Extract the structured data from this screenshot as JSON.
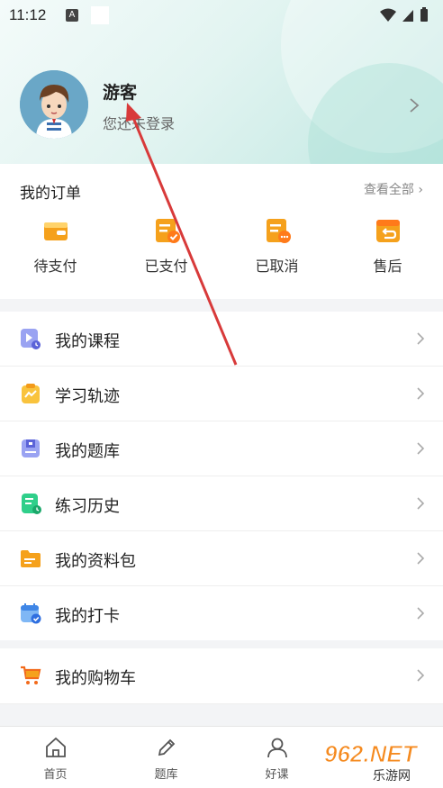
{
  "status_bar": {
    "time": "11:12",
    "notif_icon_letter": "A"
  },
  "profile": {
    "username": "游客",
    "login_hint": "您还未登录"
  },
  "orders": {
    "title": "我的订单",
    "view_all": "查看全部",
    "items": [
      {
        "label": "待支付",
        "icon": "wallet-icon"
      },
      {
        "label": "已支付",
        "icon": "paid-check-icon"
      },
      {
        "label": "已取消",
        "icon": "cancelled-doc-icon"
      },
      {
        "label": "售后",
        "icon": "return-box-icon"
      }
    ]
  },
  "menu": {
    "items": [
      {
        "label": "我的课程",
        "icon": "video-course-icon"
      },
      {
        "label": "学习轨迹",
        "icon": "trend-clipboard-icon"
      },
      {
        "label": "我的题库",
        "icon": "question-bank-icon"
      },
      {
        "label": "练习历史",
        "icon": "practice-history-icon"
      },
      {
        "label": "我的资料包",
        "icon": "folder-icon"
      },
      {
        "label": "我的打卡",
        "icon": "calendar-check-icon"
      }
    ]
  },
  "cart": {
    "label": "我的购物车",
    "icon": "shopping-cart-icon"
  },
  "tabbar": {
    "items": [
      {
        "label": "首页",
        "icon": "home-icon"
      },
      {
        "label": "题库",
        "icon": "pencil-icon"
      },
      {
        "label": "好课",
        "icon": "person-icon"
      }
    ]
  },
  "watermark": {
    "text": "962.NET",
    "subtext": "乐游网"
  },
  "colors": {
    "accent_orange": "#f5a11c",
    "accent_teal": "#bfe7e1",
    "annotation_red": "#d83a3a"
  }
}
